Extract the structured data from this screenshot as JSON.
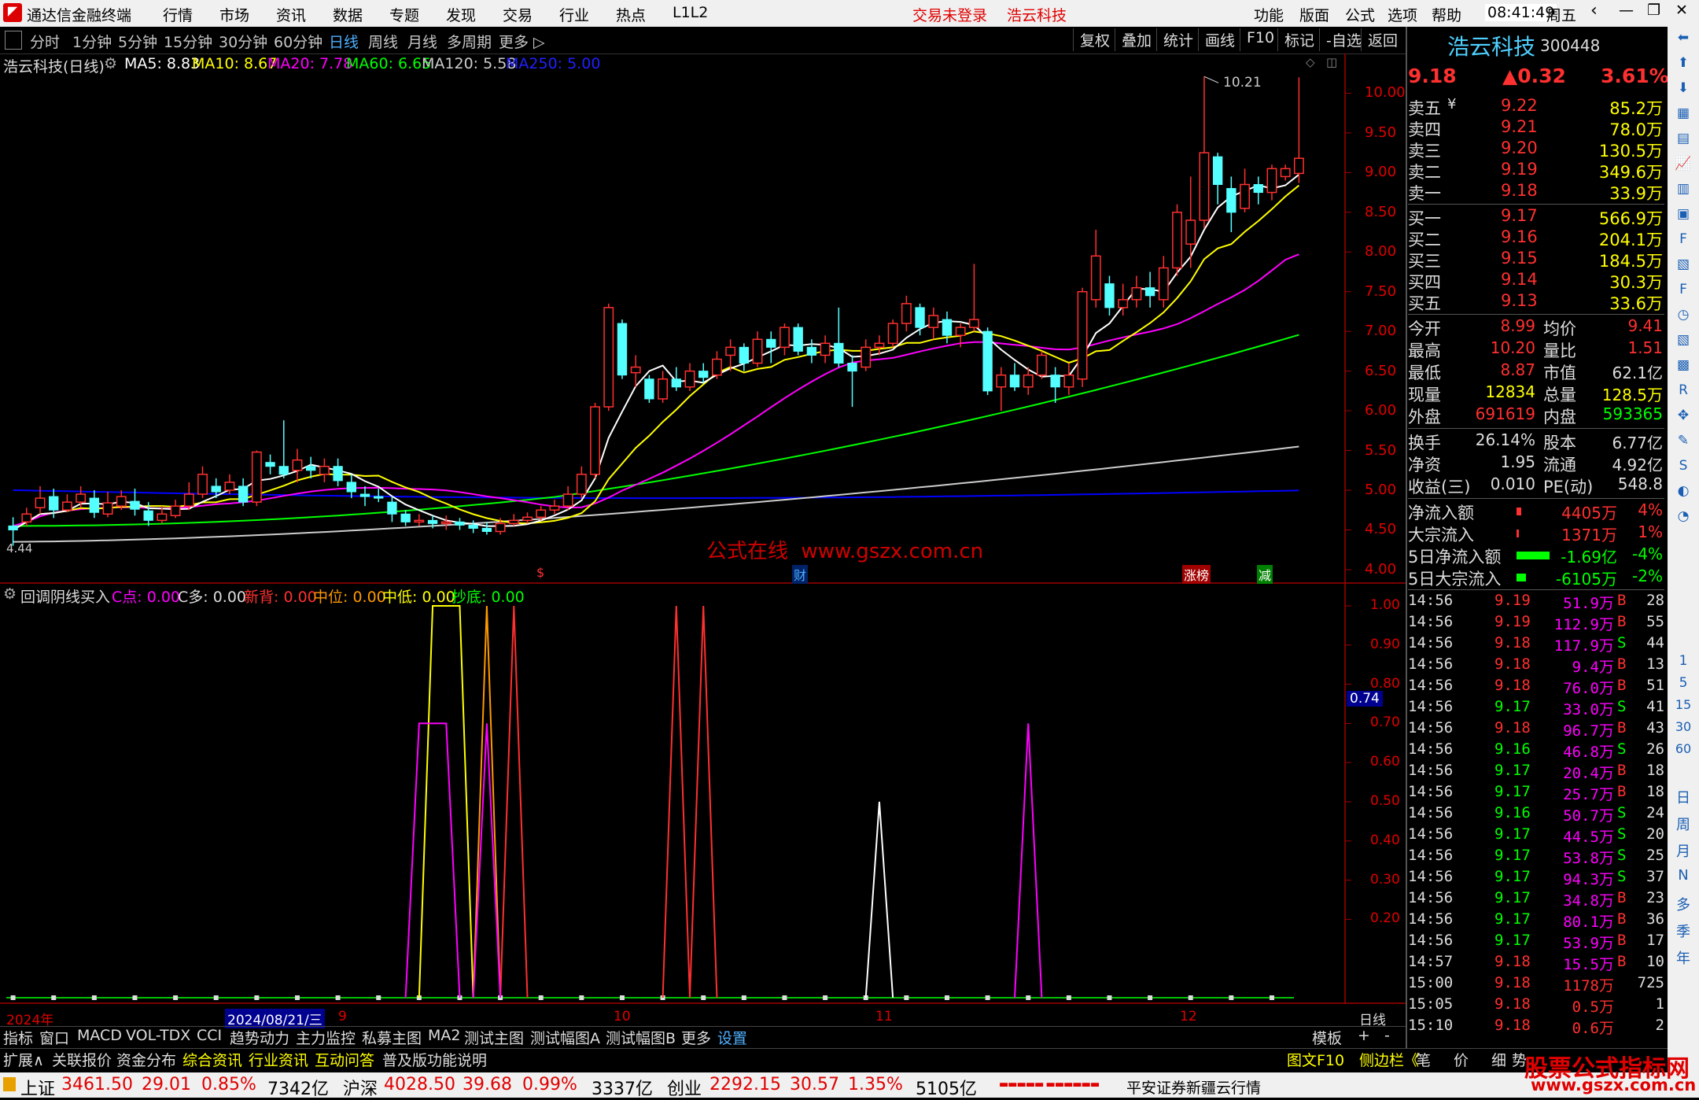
{
  "titlebar": {
    "app_name": "通达信金融终端",
    "menu": [
      "行情",
      "市场",
      "资讯",
      "数据",
      "专题",
      "发现",
      "交易",
      "行业",
      "热点",
      "L1L2"
    ],
    "login_status": "交易未登录",
    "stock_name": "浩云科技",
    "right_menu": [
      "功能",
      "版面",
      "公式",
      "选项",
      "帮助"
    ],
    "time": "08:41:49",
    "weekday": "周五"
  },
  "toolbar": {
    "periods": [
      "分时",
      "1分钟",
      "5分钟",
      "15分钟",
      "30分钟",
      "60分钟",
      "日线",
      "周线",
      "月线",
      "多周期",
      "更多 ▷"
    ],
    "active_period": "日线",
    "right_buttons": [
      "复权",
      "叠加",
      "统计",
      "画线",
      "F10",
      "标记",
      "-自选",
      "返回"
    ]
  },
  "legend": {
    "title": "浩云科技(日线)",
    "ma5": "MA5: 8.83",
    "ma10": "MA10: 8.67",
    "ma20": "MA20: 7.78",
    "ma60": "MA60: 6.65",
    "ma120": "MA120: 5.58",
    "ma250": "MA250: 5.00"
  },
  "colors": {
    "ma5": "#ffffff",
    "ma10": "#ffff00",
    "ma20": "#ff00ff",
    "ma60": "#00ff00",
    "ma120": "#cccccc",
    "ma250": "#0000ff",
    "up": "#ff3030",
    "down": "#54ffff",
    "grid": "#800000"
  },
  "price_axis": [
    "10.00",
    "9.50",
    "9.00",
    "8.50",
    "8.00",
    "7.50",
    "7.00",
    "6.50",
    "6.00",
    "5.50",
    "5.00",
    "4.50",
    "4.00"
  ],
  "high_label": "10.21",
  "low_label": "4.44",
  "watermark": "公式在线  www.gszx.com.cn",
  "event_marks": [
    "$",
    "财",
    "涨榜",
    "减"
  ],
  "chart_data": {
    "type": "candlestick",
    "title": "浩云科技(日线)",
    "ylim": [
      3.9,
      10.5
    ],
    "ohlc": [
      [
        4.55,
        4.5,
        4.3,
        4.66
      ],
      [
        4.6,
        4.7,
        4.55,
        4.78
      ],
      [
        4.78,
        4.9,
        4.7,
        5.05
      ],
      [
        4.92,
        4.75,
        4.65,
        5.02
      ],
      [
        4.75,
        4.85,
        4.72,
        4.95
      ],
      [
        4.85,
        4.95,
        4.78,
        5.05
      ],
      [
        4.9,
        4.72,
        4.65,
        5.0
      ],
      [
        4.7,
        4.84,
        4.66,
        4.98
      ],
      [
        4.8,
        4.92,
        4.75,
        5.0
      ],
      [
        4.86,
        4.76,
        4.68,
        5.02
      ],
      [
        4.74,
        4.62,
        4.55,
        4.85
      ],
      [
        4.62,
        4.7,
        4.58,
        4.8
      ],
      [
        4.68,
        4.8,
        4.65,
        4.88
      ],
      [
        4.8,
        4.95,
        4.75,
        5.1
      ],
      [
        4.95,
        5.2,
        4.9,
        5.3
      ],
      [
        5.05,
        4.98,
        4.9,
        5.15
      ],
      [
        5.0,
        5.1,
        4.95,
        5.2
      ],
      [
        5.05,
        4.85,
        4.8,
        5.15
      ],
      [
        4.85,
        5.48,
        4.8,
        5.5
      ],
      [
        5.35,
        5.3,
        5.2,
        5.45
      ],
      [
        5.3,
        5.2,
        5.15,
        5.88
      ],
      [
        5.25,
        5.38,
        5.1,
        5.52
      ],
      [
        5.3,
        5.25,
        5.15,
        5.42
      ],
      [
        5.2,
        5.3,
        5.1,
        5.4
      ],
      [
        5.3,
        5.12,
        5.05,
        5.4
      ],
      [
        5.1,
        4.98,
        4.9,
        5.2
      ],
      [
        4.95,
        4.92,
        4.8,
        5.05
      ],
      [
        4.92,
        4.9,
        4.85,
        5.02
      ],
      [
        4.85,
        4.7,
        4.6,
        4.92
      ],
      [
        4.7,
        4.6,
        4.55,
        4.75
      ],
      [
        4.6,
        4.62,
        4.55,
        4.7
      ],
      [
        4.62,
        4.58,
        4.52,
        4.68
      ],
      [
        4.58,
        4.6,
        4.5,
        4.68
      ],
      [
        4.6,
        4.56,
        4.5,
        4.65
      ],
      [
        4.56,
        4.52,
        4.46,
        4.62
      ],
      [
        4.52,
        4.48,
        4.44,
        4.6
      ],
      [
        4.48,
        4.58,
        4.44,
        4.65
      ],
      [
        4.58,
        4.62,
        4.55,
        4.7
      ],
      [
        4.62,
        4.66,
        4.58,
        4.72
      ],
      [
        4.66,
        4.75,
        4.62,
        4.8
      ],
      [
        4.75,
        4.8,
        4.7,
        4.88
      ],
      [
        4.8,
        4.95,
        4.75,
        5.05
      ],
      [
        4.95,
        5.2,
        4.9,
        5.3
      ],
      [
        5.2,
        6.05,
        5.15,
        6.1
      ],
      [
        6.05,
        7.3,
        6.0,
        7.35
      ],
      [
        7.1,
        6.45,
        6.4,
        7.15
      ],
      [
        6.48,
        6.55,
        6.3,
        6.7
      ],
      [
        6.4,
        6.15,
        6.1,
        6.45
      ],
      [
        6.15,
        6.4,
        6.1,
        6.5
      ],
      [
        6.4,
        6.3,
        6.25,
        6.55
      ],
      [
        6.3,
        6.5,
        6.25,
        6.6
      ],
      [
        6.5,
        6.42,
        6.35,
        6.6
      ],
      [
        6.45,
        6.65,
        6.4,
        6.75
      ],
      [
        6.7,
        6.8,
        6.5,
        6.9
      ],
      [
        6.8,
        6.6,
        6.5,
        6.85
      ],
      [
        6.6,
        6.9,
        6.55,
        7.0
      ],
      [
        6.9,
        6.8,
        6.6,
        7.0
      ],
      [
        6.8,
        7.05,
        6.7,
        7.1
      ],
      [
        7.05,
        6.75,
        6.7,
        7.1
      ],
      [
        6.8,
        6.7,
        6.6,
        6.9
      ],
      [
        6.7,
        6.85,
        6.6,
        6.95
      ],
      [
        6.85,
        6.6,
        6.55,
        7.3
      ],
      [
        6.6,
        6.5,
        6.05,
        6.7
      ],
      [
        6.55,
        6.8,
        6.5,
        6.9
      ],
      [
        6.8,
        6.85,
        6.7,
        6.95
      ],
      [
        6.85,
        7.1,
        6.8,
        7.15
      ],
      [
        7.1,
        7.35,
        7.0,
        7.45
      ],
      [
        7.3,
        7.05,
        6.95,
        7.35
      ],
      [
        7.05,
        7.2,
        6.9,
        7.3
      ],
      [
        7.15,
        6.95,
        6.85,
        7.25
      ],
      [
        6.95,
        7.05,
        6.8,
        7.1
      ],
      [
        7.05,
        7.15,
        7.0,
        7.85
      ],
      [
        7.0,
        6.25,
        6.2,
        7.05
      ],
      [
        6.3,
        6.45,
        6.0,
        6.55
      ],
      [
        6.45,
        6.3,
        6.25,
        6.6
      ],
      [
        6.3,
        6.45,
        6.2,
        6.55
      ],
      [
        6.45,
        6.7,
        6.4,
        6.75
      ],
      [
        6.45,
        6.3,
        6.1,
        6.55
      ],
      [
        6.3,
        6.45,
        6.2,
        6.6
      ],
      [
        6.4,
        7.5,
        6.3,
        7.55
      ],
      [
        7.4,
        7.95,
        7.3,
        8.28
      ],
      [
        7.6,
        7.3,
        7.2,
        7.7
      ],
      [
        7.3,
        7.4,
        7.2,
        7.6
      ],
      [
        7.4,
        7.55,
        7.3,
        7.7
      ],
      [
        7.55,
        7.45,
        7.3,
        7.75
      ],
      [
        7.4,
        7.8,
        7.3,
        7.95
      ],
      [
        7.8,
        8.5,
        7.7,
        8.6
      ],
      [
        8.1,
        8.4,
        7.8,
        8.95
      ],
      [
        8.4,
        9.25,
        8.3,
        10.21
      ],
      [
        9.2,
        8.85,
        8.6,
        9.25
      ],
      [
        8.8,
        8.5,
        8.25,
        8.95
      ],
      [
        8.55,
        8.85,
        8.5,
        9.05
      ],
      [
        8.85,
        8.75,
        8.6,
        8.95
      ],
      [
        8.75,
        9.05,
        8.65,
        9.1
      ],
      [
        8.95,
        9.05,
        8.9,
        9.1
      ],
      [
        8.99,
        9.18,
        8.87,
        10.2
      ]
    ]
  },
  "indicator": {
    "title": "回调阴线买入",
    "c_point": "C点: 0.00",
    "c_duo": "C多: 0.00",
    "xin_bei": "新背: 0.00",
    "zhong_wei": "中位: 0.00",
    "zhong_di": "中低: 0.00",
    "chao_di": "抄底: 0.00",
    "axis": [
      "1.00",
      "0.90",
      "0.80",
      "0.70",
      "0.60",
      "0.50",
      "0.40",
      "0.30",
      "0.20"
    ],
    "cursor_value": "0.74",
    "pulses": [
      {
        "series": "C多",
        "color": "#ffff00",
        "bars": [
          31,
          32,
          33
        ],
        "value": 1.0
      },
      {
        "series": "中位",
        "color": "#ff9900",
        "bars": [
          35
        ],
        "value": 1.0
      },
      {
        "series": "新背",
        "color": "#ff3030",
        "bars": [
          37
        ],
        "value": 1.0
      },
      {
        "series": "新背",
        "color": "#ff3030",
        "bars": [
          49
        ],
        "value": 1.0
      },
      {
        "series": "新背",
        "color": "#ff3030",
        "bars": [
          51
        ],
        "value": 1.0
      },
      {
        "series": "C点",
        "color": "#ff00ff",
        "bars": [
          30,
          31,
          32
        ],
        "value": 0.7
      },
      {
        "series": "C点",
        "color": "#ff00ff",
        "bars": [
          35
        ],
        "value": 0.7
      },
      {
        "series": "中低",
        "color": "#ffffff",
        "bars": [
          64
        ],
        "value": 0.5
      },
      {
        "series": "C点",
        "color": "#ff00ff",
        "bars": [
          75
        ],
        "value": 0.7
      }
    ]
  },
  "date_axis": {
    "year": "2024年",
    "cursor": "2024/08/21/三",
    "months": [
      "9",
      "10",
      "11",
      "12"
    ],
    "period": "日线"
  },
  "quote": {
    "name": "浩云科技",
    "code": "300448",
    "price": "9.18",
    "change": "▲0.32",
    "pct": "3.61%",
    "asks": [
      {
        "label": "卖五",
        "flag": "¥",
        "price": "9.22",
        "vol": "85.2万"
      },
      {
        "label": "卖四",
        "flag": "",
        "price": "9.21",
        "vol": "78.0万"
      },
      {
        "label": "卖三",
        "flag": "",
        "price": "9.20",
        "vol": "130.5万"
      },
      {
        "label": "卖二",
        "flag": "",
        "price": "9.19",
        "vol": "349.6万"
      },
      {
        "label": "卖一",
        "flag": "",
        "price": "9.18",
        "vol": "33.9万"
      }
    ],
    "bids": [
      {
        "label": "买一",
        "price": "9.17",
        "vol": "566.9万"
      },
      {
        "label": "买二",
        "price": "9.16",
        "vol": "204.1万"
      },
      {
        "label": "买三",
        "price": "9.15",
        "vol": "184.5万"
      },
      {
        "label": "买四",
        "price": "9.14",
        "vol": "30.3万"
      },
      {
        "label": "买五",
        "price": "9.13",
        "vol": "33.6万"
      }
    ],
    "stats": [
      [
        "今开",
        "8.99",
        "均价",
        "9.41"
      ],
      [
        "最高",
        "10.20",
        "量比",
        "1.51"
      ],
      [
        "最低",
        "8.87",
        "市值",
        "62.1亿"
      ],
      [
        "现量",
        "12834",
        "总量",
        "128.5万"
      ],
      [
        "外盘",
        "691619",
        "内盘",
        "593365"
      ]
    ],
    "stats2": [
      [
        "换手",
        "26.14%",
        "股本",
        "6.77亿"
      ],
      [
        "净资",
        "1.95",
        "流通",
        "4.92亿"
      ],
      [
        "收益(三)",
        "0.010",
        "PE(动)",
        "548.8"
      ]
    ],
    "flows": [
      {
        "label": "净流入额",
        "value": "4405万",
        "pct": "4%",
        "color": "#ff3030",
        "bar": 0.1
      },
      {
        "label": "大宗流入",
        "value": "1371万",
        "pct": "1%",
        "color": "#ff3030",
        "bar": 0.02
      },
      {
        "label": "5日净流入额",
        "value": "-1.69亿",
        "pct": "-4%",
        "color": "#00ff00",
        "bar": 0.7
      },
      {
        "label": "5日大宗流入",
        "value": "-6105万",
        "pct": "-2%",
        "color": "#00ff00",
        "bar": 0.2
      }
    ],
    "ticks": [
      [
        "14:56",
        "9.19",
        "51.9万",
        "B",
        "28"
      ],
      [
        "14:56",
        "9.19",
        "112.9万",
        "B",
        "55"
      ],
      [
        "14:56",
        "9.18",
        "117.9万",
        "S",
        "44"
      ],
      [
        "14:56",
        "9.18",
        "9.4万",
        "B",
        "13"
      ],
      [
        "14:56",
        "9.18",
        "76.0万",
        "B",
        "51"
      ],
      [
        "14:56",
        "9.17",
        "33.0万",
        "S",
        "41"
      ],
      [
        "14:56",
        "9.18",
        "96.7万",
        "B",
        "43"
      ],
      [
        "14:56",
        "9.16",
        "46.8万",
        "S",
        "26"
      ],
      [
        "14:56",
        "9.17",
        "20.4万",
        "B",
        "18"
      ],
      [
        "14:56",
        "9.17",
        "25.7万",
        "B",
        "18"
      ],
      [
        "14:56",
        "9.16",
        "50.7万",
        "S",
        "24"
      ],
      [
        "14:56",
        "9.17",
        "44.5万",
        "S",
        "20"
      ],
      [
        "14:56",
        "9.17",
        "53.8万",
        "S",
        "25"
      ],
      [
        "14:56",
        "9.17",
        "94.3万",
        "S",
        "37"
      ],
      [
        "14:56",
        "9.17",
        "34.8万",
        "B",
        "23"
      ],
      [
        "14:56",
        "9.17",
        "80.1万",
        "B",
        "36"
      ],
      [
        "14:56",
        "9.17",
        "53.9万",
        "B",
        "17"
      ],
      [
        "14:57",
        "9.18",
        "15.5万",
        "B",
        "10"
      ],
      [
        "15:00",
        "9.18",
        "1178万",
        "",
        "725"
      ],
      [
        "15:05",
        "9.18",
        "0.5万",
        "",
        "1"
      ],
      [
        "15:10",
        "9.18",
        "0.6万",
        "",
        "2"
      ]
    ]
  },
  "bottom_tabs": [
    "指标",
    "窗口",
    "MACD",
    "VOL-TDX",
    "CCI",
    "趋势动力",
    "主力监控",
    "私募主图",
    "MA2",
    "测试主图",
    "测试幅图A",
    "测试幅图B",
    "更多",
    "设置"
  ],
  "bottom_right": [
    "模板",
    "+",
    "-"
  ],
  "bottom_tabs2": [
    "扩展∧",
    "关联报价",
    "资金分布",
    "综合资讯",
    "行业资讯",
    "互动问答",
    "普及版功能说明"
  ],
  "bottom_right2": [
    "图文F10",
    "侧边栏《",
    "笔",
    "价",
    "细",
    "势"
  ],
  "sidebar_icons": [
    "日",
    "周",
    "月",
    "N",
    "多",
    "季",
    "年"
  ],
  "status": {
    "sh_name": "上证",
    "sh_val": "3461.50",
    "sh_chg": "29.01",
    "sh_pct": "0.85%",
    "sh_amt": "7342亿",
    "hs_name": "沪深",
    "hs_val": "4028.50",
    "hs_chg": "39.68",
    "hs_pct": "0.99%",
    "hs_amt": "3337亿",
    "cy_name": "创业",
    "cy_val": "2292.15",
    "cy_chg": "30.57",
    "cy_pct": "1.35%",
    "cy_amt": "5105亿",
    "broker": "平安证券新疆云行情",
    "logo_text": "股票公式指标网",
    "logo_url": "www.gszx.com.cn"
  }
}
